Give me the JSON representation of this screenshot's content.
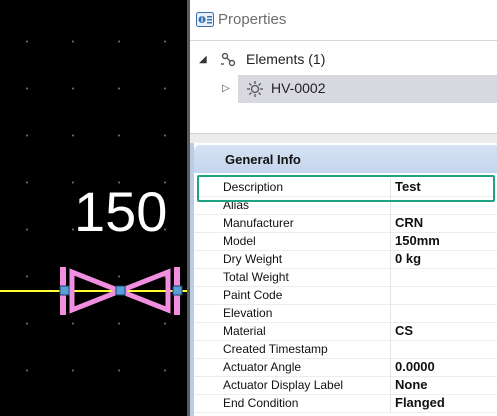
{
  "canvas": {
    "dimension_label": "150",
    "valve_color": "#f08ee0",
    "pipe_color": "#ffff33",
    "handle_color": "#5aa0d8"
  },
  "panel": {
    "title": "Properties",
    "title_icon": "properties-icon",
    "tree": {
      "root_label": "Elements (1)",
      "root_icon": "elements-icon",
      "child_label": "HV-0002",
      "child_icon": "valve-gear-icon"
    },
    "group_title": "General Info",
    "properties": [
      {
        "label": "Description",
        "value": "Test"
      },
      {
        "label": "Alias",
        "value": ""
      },
      {
        "label": "Manufacturer",
        "value": "CRN"
      },
      {
        "label": "Model",
        "value": "150mm"
      },
      {
        "label": "Dry Weight",
        "value": "0 kg"
      },
      {
        "label": "Total Weight",
        "value": ""
      },
      {
        "label": "Paint Code",
        "value": ""
      },
      {
        "label": "Elevation",
        "value": ""
      },
      {
        "label": "Material",
        "value": "CS"
      },
      {
        "label": "Created Timestamp",
        "value": ""
      },
      {
        "label": "Actuator Angle",
        "value": "0.0000"
      },
      {
        "label": "Actuator Display Label",
        "value": "None"
      },
      {
        "label": "End Condition",
        "value": "Flanged"
      }
    ],
    "highlight_color": "#1ea382"
  }
}
